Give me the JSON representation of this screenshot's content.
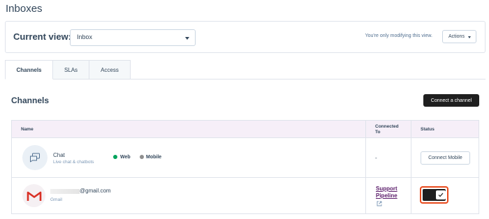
{
  "page": {
    "title": "Inboxes"
  },
  "view_bar": {
    "label": "Current view:",
    "selected": "Inbox",
    "note": "You're only modifying this view.",
    "actions_label": "Actions"
  },
  "tabs": [
    {
      "label": "Channels",
      "active": true
    },
    {
      "label": "SLAs",
      "active": false
    },
    {
      "label": "Access",
      "active": false
    }
  ],
  "section": {
    "title": "Channels",
    "connect_label": "Connect a channel"
  },
  "table": {
    "headers": {
      "name": "Name",
      "connected": "Connected To",
      "status": "Status"
    },
    "rows": [
      {
        "name": "Chat",
        "subtitle": "Live chat & chatbots",
        "tags": [
          "Web",
          "Mobile"
        ],
        "connected": "-",
        "status_button": "Connect Mobile",
        "icon": "chat-icon"
      },
      {
        "name": "@gmail.com",
        "subtitle": "Gmail",
        "connected": "Support Pipeline",
        "status": "on",
        "icon": "gmail-icon"
      }
    ]
  },
  "colors": {
    "accent": "#e8491b",
    "dark_button": "#1f1f1f",
    "header_bg": "#f6eff8",
    "link": "#5c1e6b",
    "web_dot": "#00a35c",
    "mobile_dot": "#8e8e8e"
  }
}
